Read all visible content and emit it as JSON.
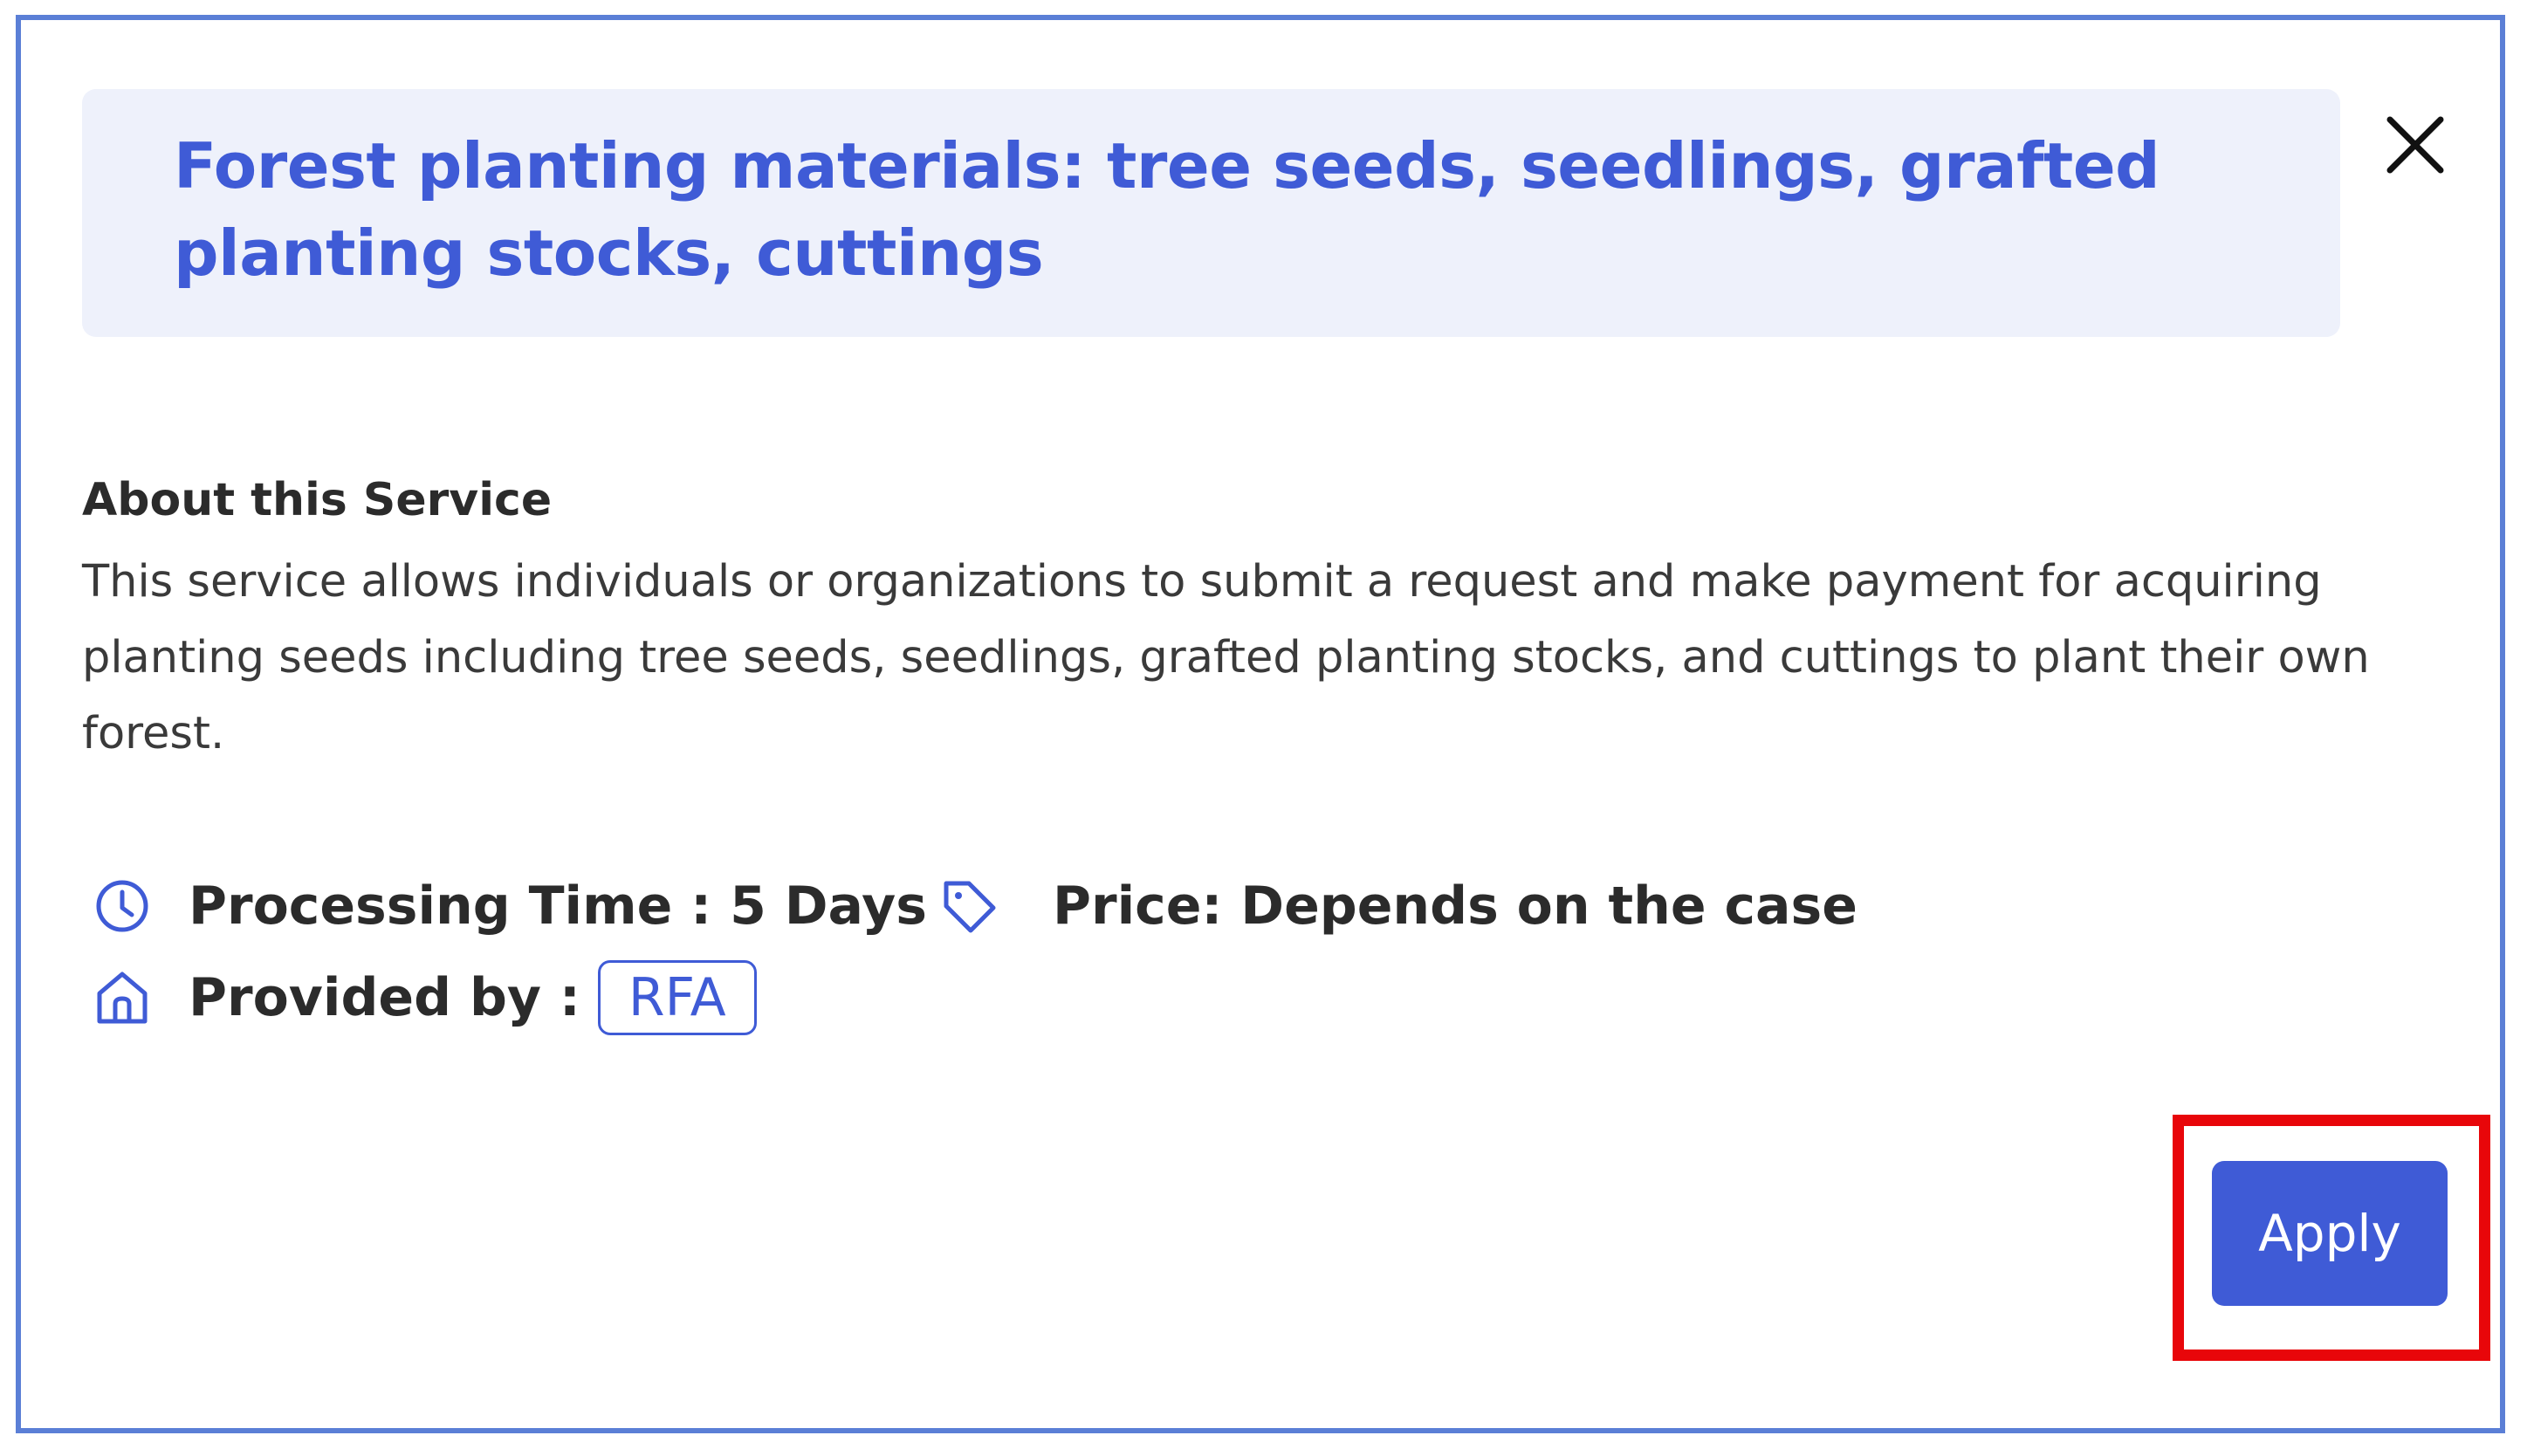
{
  "dialog": {
    "title": "Forest planting materials: tree seeds, seedlings, grafted planting stocks, cuttings",
    "close_icon": "close-icon"
  },
  "about": {
    "heading": "About this Service",
    "description": "This service allows individuals or organizations to submit a request and make payment for acquiring planting seeds including tree seeds, seedlings, grafted planting stocks, and cuttings to plant their own forest."
  },
  "meta": {
    "processing_time": "Processing Time : 5 Days",
    "processing_icon": "clock-icon",
    "price": "Price: Depends on the case",
    "price_icon": "tag-icon",
    "provided_by_label": "Provided by :",
    "provided_by_icon": "home-icon",
    "provider": "RFA"
  },
  "actions": {
    "apply_label": "Apply"
  },
  "colors": {
    "accent": "#3f5bd6",
    "title_bg": "#eef1fb",
    "frame_border": "#5b7fd6",
    "highlight": "#e8060a"
  }
}
